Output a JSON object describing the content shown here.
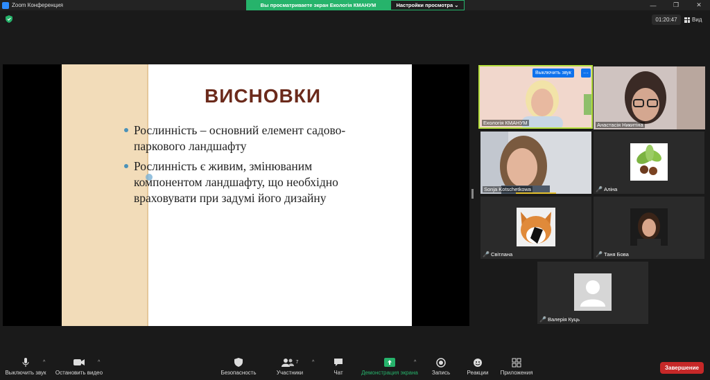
{
  "window": {
    "title": "Zoom Конференция",
    "share_banner": "Вы просматриваете экран Екологія КМАНУМ",
    "view_options": "Настройки просмотра ⌄",
    "controls": [
      "—",
      "❐",
      "✕"
    ]
  },
  "header": {
    "timer": "01:20:47",
    "view_label": "Вид"
  },
  "slide": {
    "title": "ВИСНОВКИ",
    "bullets": [
      {
        "line1": "Рослинність – основний елемент садово-",
        "line2": "паркового ландшафту"
      },
      {
        "line1": "Рослинність є живим, змінюваним",
        "line2": "компонентом ландшафту, що необхідно",
        "line3": "враховувати при задумі його дизайну"
      }
    ]
  },
  "participants": [
    {
      "name": "Екологія КМАНУМ",
      "mute_label": "Выключить звук",
      "more": "···"
    },
    {
      "name": "Анастасія Никитіна"
    },
    {
      "name": "Sonja Kotschetkowa"
    },
    {
      "name": "Аліна",
      "mic_off": "🎤"
    },
    {
      "name": "Світлана",
      "mic_off": "🎤"
    },
    {
      "name": "Таня Бова",
      "mic_off": "🎤"
    },
    {
      "name": "Валерія Куць",
      "mic_off": "🎤"
    }
  ],
  "toolbar": {
    "mute": "Выключить звук",
    "stop_video": "Остановить видео",
    "security": "Безопасность",
    "participants": "Участники",
    "participants_count": "7",
    "chat": "Чат",
    "share": "Демонстрация экрана",
    "record": "Запись",
    "reactions": "Реакции",
    "apps": "Приложения",
    "end": "Завершение"
  },
  "colors": {
    "share_green": "#26b36b",
    "active_speaker": "#b6e03d",
    "slide_title": "#6b2a1b",
    "end_red": "#c62828"
  }
}
